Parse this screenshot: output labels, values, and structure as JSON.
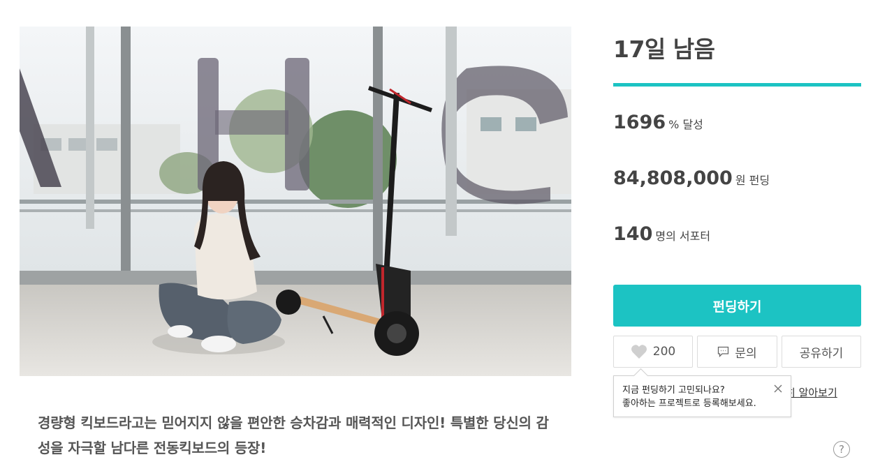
{
  "campaign": {
    "remaining": "17일 남음",
    "progress_percent": 100,
    "accent_color": "#1cc3c3",
    "stats": {
      "rate_value": "1696",
      "rate_unit": "% 달성",
      "amount_value": "84,808,000",
      "amount_unit": "원 펀딩",
      "supporters_value": "140",
      "supporters_unit": "명의 서포터"
    },
    "fund_button_label": "펀딩하기",
    "actions": {
      "like_count": "200",
      "like_icon": "heart-icon",
      "inquiry_label": "문의",
      "inquiry_icon": "chat-bubble-icon",
      "share_label": "공유하기"
    },
    "learn_more_visible": "히 알아보기",
    "tooltip": {
      "line1": "지금 펀딩하기 고민되나요?",
      "line2": "좋아하는 프로젝트로 등록해보세요."
    },
    "help_icon_glyph": "?"
  },
  "description": {
    "text": "경량형 킥보드라고는 믿어지지 않을 편안한 승차감과 매력적인 디자인! 특별한 당신의 감성을 자극할 남다른 전동킥보드의 등장!"
  }
}
